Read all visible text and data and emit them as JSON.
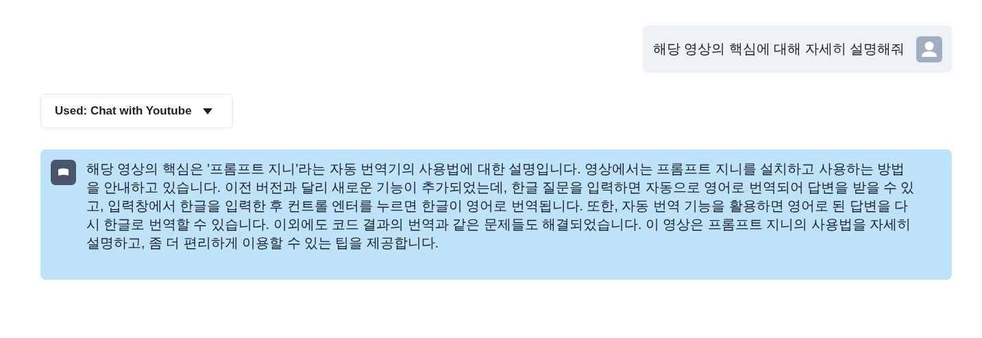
{
  "messages": [
    {
      "kind": "user",
      "text": "해당 영상의 핵심에 대해 자세히 설명해줘"
    },
    {
      "kind": "tool",
      "text": "Used: Chat with Youtube"
    },
    {
      "kind": "assistant",
      "text": "해당 영상의 핵심은 '프롬프트 지니'라는 자동 번역기의 사용법에 대한 설명입니다. 영상에서는 프롬프트 지니를 설치하고 사용하는 방법을 안내하고 있습니다. 이전 버전과 달리 새로운 기능이 추가되었는데, 한글 질문을 입력하면 자동으로 영어로 번역되어 답변을 받을 수 있고, 입력창에서 한글을 입력한 후 컨트롤 엔터를 누르면 한글이 영어로 번역됩니다. 또한, 자동 번역 기능을 활용하면 영어로 된 답변을 다시 한글로 번역할 수 있습니다. 이외에도 코드 결과의 번역과 같은 문제들도 해결되었습니다. 이 영상은 프롬프트 지니의 사용법을 자세히 설명하고, 좀 더 편리하게 이용할 수 있는 팁을 제공합니다."
    }
  ]
}
